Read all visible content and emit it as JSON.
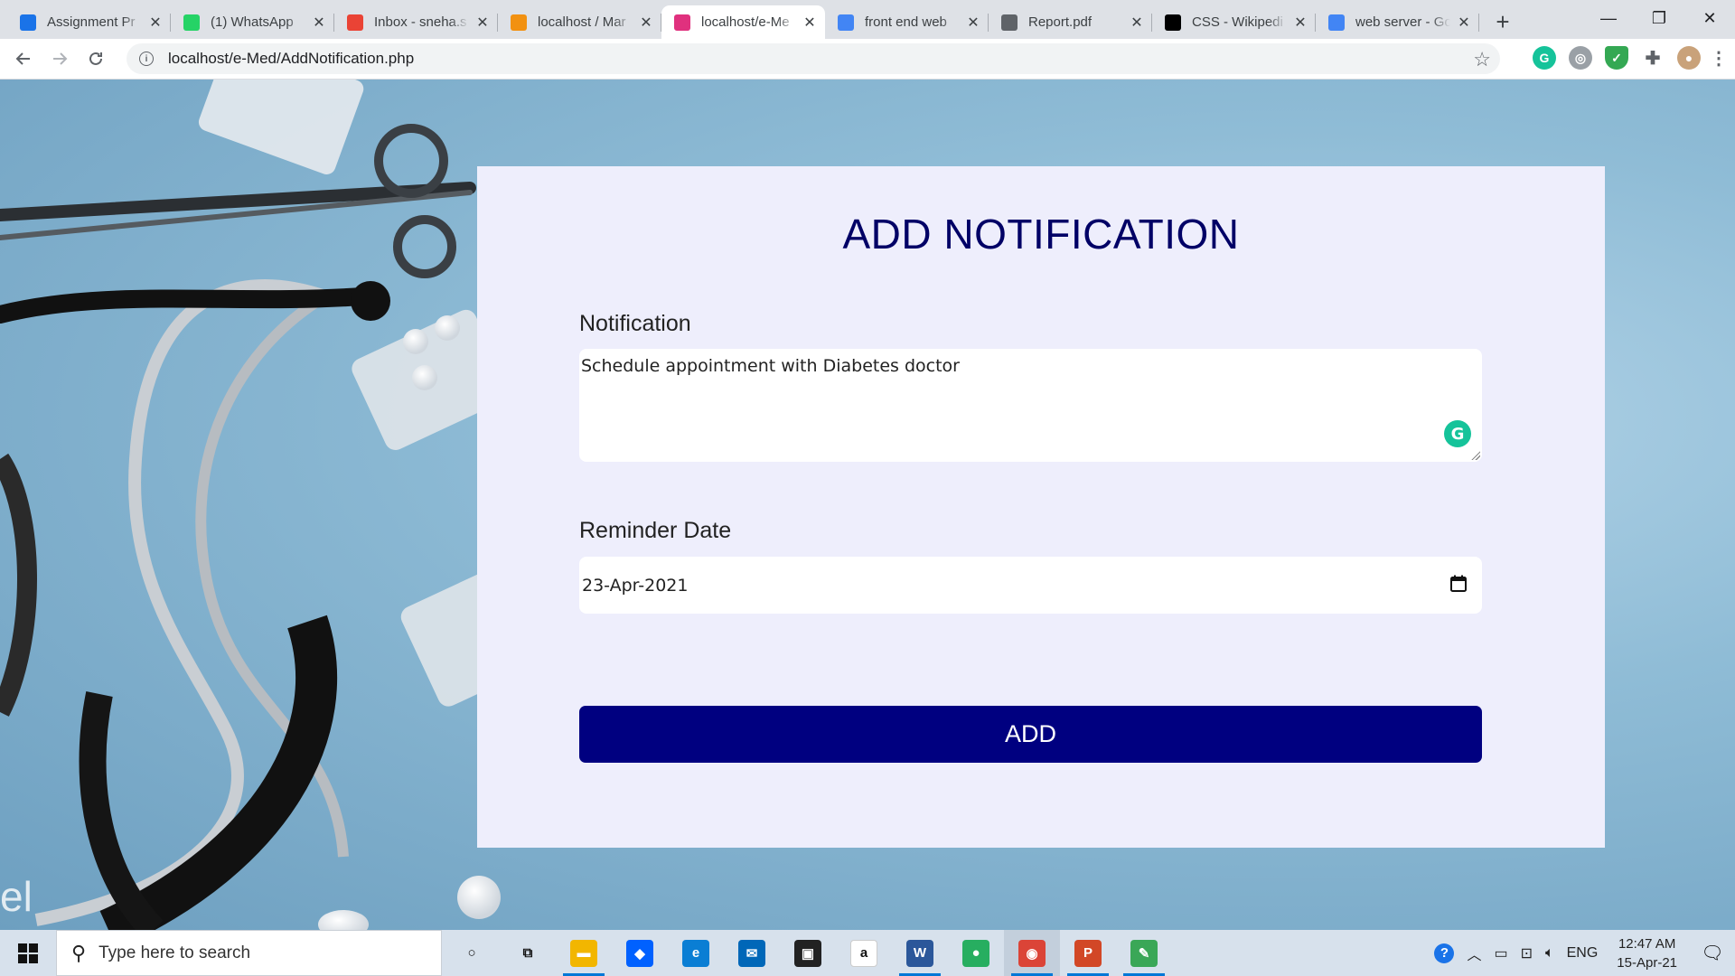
{
  "browser": {
    "tabs": [
      {
        "title": "Assignment Pr",
        "icon": "classroom-icon",
        "color": "#1a73e8"
      },
      {
        "title": "(1) WhatsApp",
        "icon": "whatsapp-icon",
        "color": "#25d366"
      },
      {
        "title": "Inbox - sneha.s",
        "icon": "gmail-icon",
        "color": "#ea4335"
      },
      {
        "title": "localhost / Mar",
        "icon": "phpmyadmin-icon",
        "color": "#f29111"
      },
      {
        "title": "localhost/e-Me",
        "icon": "emed-icon",
        "color": "#e0317e",
        "active": true
      },
      {
        "title": "front end web",
        "icon": "google-icon",
        "color": "#4285f4"
      },
      {
        "title": "Report.pdf",
        "icon": "globe-icon",
        "color": "#5f6368"
      },
      {
        "title": "CSS - Wikipedi",
        "icon": "wikipedia-icon",
        "color": "#000000"
      },
      {
        "title": "web server - Go",
        "icon": "google-icon",
        "color": "#4285f4"
      }
    ],
    "url": "localhost/e-Med/AddNotification.php",
    "window": {
      "minimize": "—",
      "restore": "❐",
      "close": "✕"
    }
  },
  "form": {
    "title": "ADD NOTIFICATION",
    "notification_label": "Notification",
    "notification_value": "Schedule appointment with Diabetes doctor",
    "reminder_label": "Reminder Date",
    "reminder_value": "23-Apr-2021",
    "submit_label": "ADD"
  },
  "taskbar": {
    "search_placeholder": "Type here to search",
    "apps": [
      {
        "name": "cortana-icon",
        "symbol": "○",
        "color": "transparent"
      },
      {
        "name": "task-view-icon",
        "symbol": "⧉",
        "color": "transparent"
      },
      {
        "name": "file-explorer-icon",
        "symbol": "▬",
        "color": "#f2b600",
        "running": true
      },
      {
        "name": "dropbox-icon",
        "symbol": "◆",
        "color": "#0061ff"
      },
      {
        "name": "edge-icon",
        "symbol": "e",
        "color": "#0a7ed4"
      },
      {
        "name": "mail-icon",
        "symbol": "✉",
        "color": "#0067b8"
      },
      {
        "name": "store-icon",
        "symbol": "▣",
        "color": "#222222"
      },
      {
        "name": "amazon-icon",
        "symbol": "a",
        "color": "#ffffff"
      },
      {
        "name": "word-icon",
        "symbol": "W",
        "color": "#2b579a",
        "running": true
      },
      {
        "name": "maps-icon",
        "symbol": "●",
        "color": "#27ae60"
      },
      {
        "name": "chrome-icon",
        "symbol": "◉",
        "color": "#db4437",
        "running": true,
        "active": true
      },
      {
        "name": "powerpoint-icon",
        "symbol": "P",
        "color": "#d24726",
        "running": true
      },
      {
        "name": "paint-icon",
        "symbol": "✎",
        "color": "#3aa757",
        "running": true
      }
    ],
    "language": "ENG",
    "time": "12:47 AM",
    "date": "15-Apr-21"
  },
  "colors": {
    "accent": "#000080",
    "title": "#000066",
    "card": "#eeeefc"
  }
}
